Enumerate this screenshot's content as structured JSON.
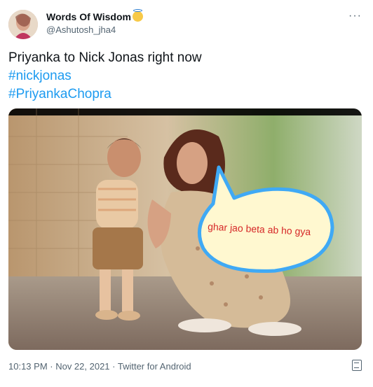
{
  "header": {
    "display_name": "Words Of Wisdom",
    "handle": "@Ashutosh_jha4",
    "verified_emoji": "smiling-face-with-halo-emoji",
    "more_icon": "more-icon"
  },
  "tweet": {
    "text": "Priyanka to Nick Jonas right now",
    "hashtags": [
      "#nickjonas",
      "#PriyankaChopra"
    ]
  },
  "media": {
    "speech_bubble_text": "ghar jao beta ab ho gya"
  },
  "meta": {
    "time": "10:13 PM · Nov 22, 2021 · Twitter for Android",
    "analytics_icon": "analytics-icon"
  },
  "colors": {
    "text": "#0f1419",
    "muted": "#536471",
    "link": "#1d9bf0",
    "bubble_fill": "#fff8d0",
    "bubble_stroke": "#3fa9f5",
    "bubble_text": "#d62828"
  }
}
